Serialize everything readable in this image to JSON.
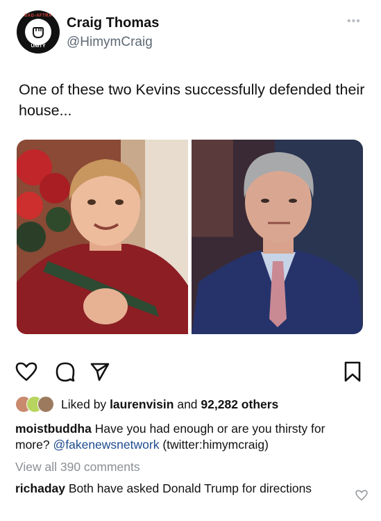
{
  "tweet": {
    "author_name": "Craig Thomas",
    "author_handle": "@HimymCraig",
    "avatar_top_text": "SAG-AFTRA",
    "avatar_bottom_text": "UNITY",
    "text": "One of these two Kevins successfully defended their house...",
    "more_icon": "ellipsis-icon"
  },
  "instagram": {
    "likes": {
      "prefix": "Liked by",
      "user": "laurenvisin",
      "connector": "and",
      "count": "92,282 others"
    },
    "caption": {
      "user": "moistbuddha",
      "text": "Have you had enough or are you thirsty for more?",
      "mention": "@fakenewsnetwork",
      "suffix": "(twitter:himymcraig)"
    },
    "view_all": "View all 390 comments",
    "comment": {
      "user": "richaday",
      "text": "Both have asked Donald Trump for directions"
    }
  },
  "colors": {
    "link": "#1f4b8f",
    "muted": "#8a8f94",
    "handle": "#5d6873"
  }
}
